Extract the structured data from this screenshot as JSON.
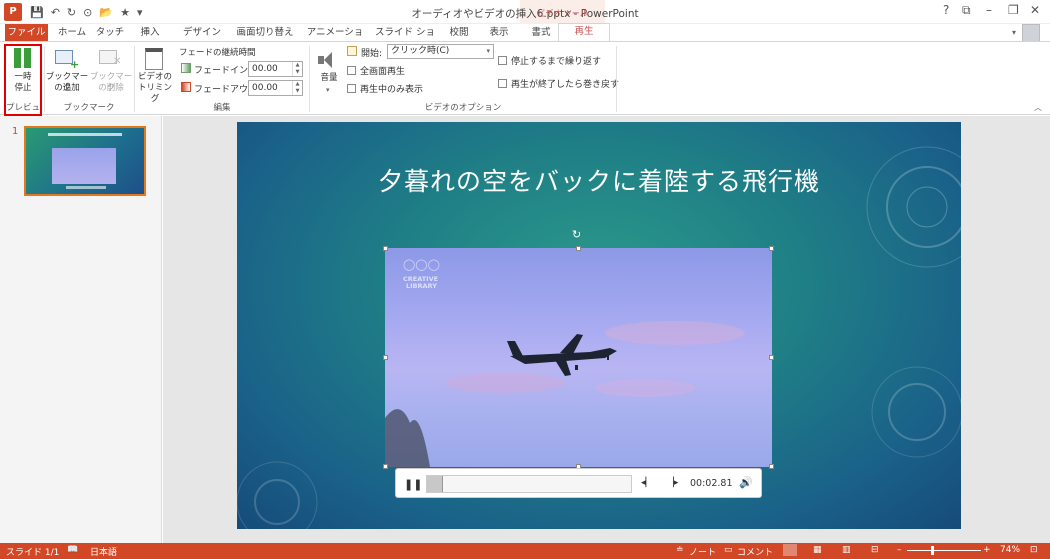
{
  "window": {
    "title": "オーディオやビデオの挿入6.pptx - PowerPoint",
    "context_tool": "ビデオ ツール",
    "help": "?",
    "user_dropdown": "▾"
  },
  "tabs": [
    {
      "label": "ファイル"
    },
    {
      "label": "ホーム"
    },
    {
      "label": "タッチ"
    },
    {
      "label": "挿入"
    },
    {
      "label": "デザイン"
    },
    {
      "label": "画面切り替え"
    },
    {
      "label": "アニメーション"
    },
    {
      "label": "スライド ショー"
    },
    {
      "label": "校閲"
    },
    {
      "label": "表示"
    },
    {
      "label": "書式"
    },
    {
      "label": "再生"
    }
  ],
  "ribbon": {
    "preview": {
      "pause_line1": "一時",
      "pause_line2": "停止",
      "group": "プレビュー"
    },
    "bookmark": {
      "add_line1": "ブックマーク",
      "add_line2": "の追加",
      "remove_line1": "ブックマーク",
      "remove_line2": "の削除",
      "group": "ブックマーク"
    },
    "edit": {
      "trim_line1": "ビデオの",
      "trim_line2": "トリミング",
      "fade_title": "フェードの継続時間",
      "fade_in_label": "フェードイン:",
      "fade_in_value": "00.00",
      "fade_out_label": "フェードアウト:",
      "fade_out_value": "00.00",
      "group": "編集"
    },
    "video_options": {
      "volume": "音量",
      "start_label": "開始:",
      "start_value": "クリック時(C)",
      "fullscreen": "全画面再生",
      "hide_not_playing": "再生中のみ表示",
      "loop": "停止するまで繰り返す",
      "rewind": "再生が終了したら巻き戻す",
      "group": "ビデオのオプション"
    }
  },
  "thumbnail": {
    "number": "1"
  },
  "slide": {
    "title": "夕暮れの空をバックに着陸する飛行機",
    "watermark_line1": "CREATIVE",
    "watermark_line2": "LIBRARY"
  },
  "player": {
    "time": "00:02.81",
    "progress": 0.08
  },
  "status": {
    "slide": "スライド 1/1",
    "language": "日本語",
    "notes": "ノート",
    "comments": "コメント",
    "zoom": "74%"
  }
}
